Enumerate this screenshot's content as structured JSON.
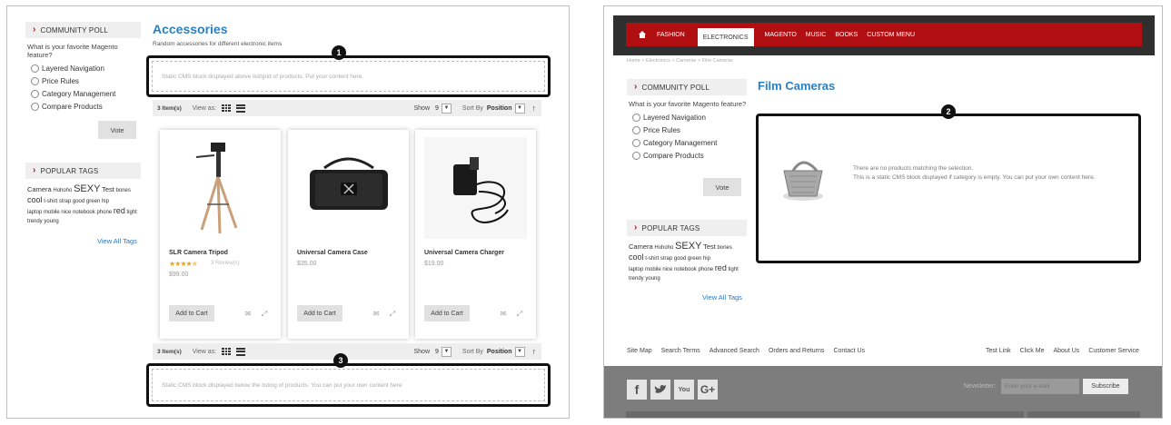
{
  "left": {
    "poll": {
      "heading": "COMMUNITY POLL",
      "question": "What is your favorite Magento feature?",
      "options": [
        "Layered Navigation",
        "Price Rules",
        "Category Management",
        "Compare Products"
      ],
      "vote_label": "Vote"
    },
    "tags": {
      "heading": "POPULAR TAGS",
      "items": [
        "Camera",
        "Hohoho",
        "SEXY",
        "Test",
        "bones",
        "cool",
        "t-shirt",
        "shirt",
        "strap",
        "good",
        "green",
        "hip",
        "laptop",
        "mobile",
        "nice",
        "notebook",
        "phone",
        "red",
        "tight",
        "trendy",
        "young"
      ],
      "view_all": "View All Tags"
    },
    "category": {
      "title": "Accessories",
      "description": "Random accessories for different electronic items"
    },
    "cms_top": "Static CMS block displayed above list/grid of products. Put your content here.",
    "cms_bottom": "Static CMS block displayed below the listing of products. You can put your own content here",
    "toolbar": {
      "count": "3 Item(s)",
      "view_as": "View as:",
      "show": "Show",
      "show_value": "9",
      "sort_by": "Sort By",
      "sort_value": "Position"
    },
    "callouts": [
      "1",
      "3"
    ],
    "products": [
      {
        "name": "SLR Camera Tripod",
        "price": "$99.00",
        "rating": 4.5,
        "reviews": "3 Review(s)",
        "cart": "Add to Cart"
      },
      {
        "name": "Universal Camera Case",
        "price": "$35.00",
        "cart": "Add to Cart"
      },
      {
        "name": "Universal Camera Charger",
        "price": "$19.00",
        "cart": "Add to Cart"
      }
    ]
  },
  "right": {
    "nav": [
      "FASHION",
      "ELECTRONICS",
      "MAGENTO",
      "MUSIC",
      "BOOKS",
      "CUSTOM MENU"
    ],
    "nav_active": "ELECTRONICS",
    "breadcrumb": "Home > Electronics > Cameras > Film Cameras",
    "poll": {
      "heading": "COMMUNITY POLL",
      "question": "What is your favorite Magento feature?",
      "options": [
        "Layered Navigation",
        "Price Rules",
        "Category Management",
        "Compare Products"
      ],
      "vote_label": "Vote"
    },
    "tags": {
      "heading": "POPULAR TAGS",
      "view_all": "View All Tags"
    },
    "category_title": "Film Cameras",
    "callout": "2",
    "empty_line1": "There are no products matching the selection.",
    "empty_line2": "This is a static CMS block displayed if category is empty. You can put your own content here.",
    "footer_links_left": [
      "Site Map",
      "Search Terms",
      "Advanced Search",
      "Orders and Returns",
      "Contact Us"
    ],
    "footer_links_right": [
      "Test Link",
      "Click Me",
      "About Us",
      "Customer Service"
    ],
    "newsletter_label": "Newsletter:",
    "newsletter_placeholder": "Enter your e-mail",
    "subscribe": "Subscribe",
    "social_icons": [
      "facebook-icon",
      "twitter-icon",
      "youtube-icon",
      "google-plus-icon"
    ]
  },
  "colors": {
    "accent_blue": "#2a80c6",
    "nav_red": "#b10e12",
    "chevron_red": "#c0121a",
    "star": "#e8a21b"
  }
}
